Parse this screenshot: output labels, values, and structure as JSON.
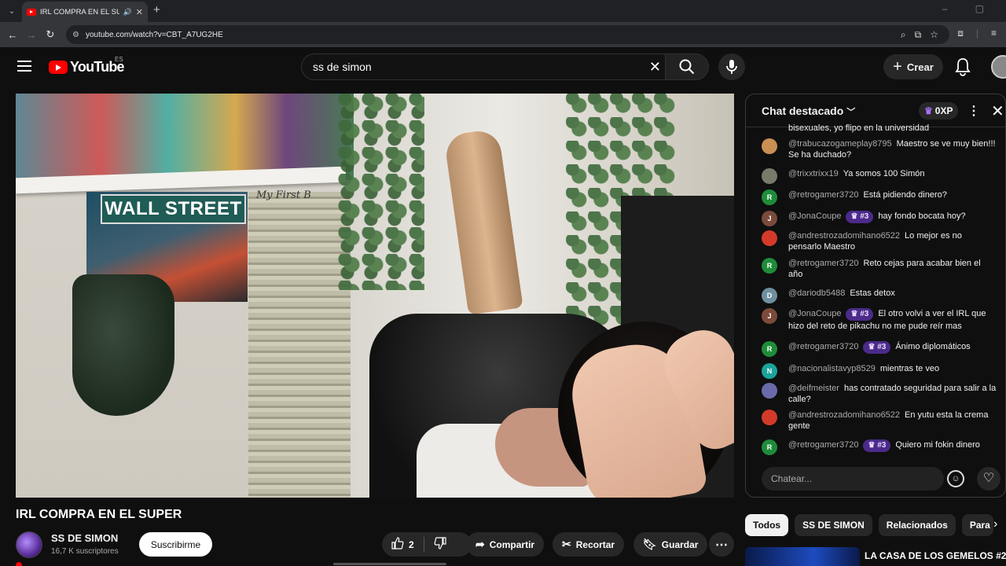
{
  "browser": {
    "tab_title": "IRL COMPRA EN EL SUPER",
    "url": "youtube.com/watch?v=CBT_A7UG2HE"
  },
  "youtube": {
    "logo_text": "YouTube",
    "country_code": "ES",
    "search_value": "ss de simon",
    "create_label": "Crear"
  },
  "video": {
    "poster_text": "WALL STREET",
    "poster_subtext": "My First B"
  },
  "chat": {
    "title": "Chat destacado",
    "xp_label": "0XP",
    "input_placeholder": "Chatear...",
    "messages": [
      {
        "user": "",
        "text": "bisexuales, yo flipo en la universidad",
        "initial": "",
        "color": "#0f0f0f"
      },
      {
        "user": "@trabucazogameplay8795",
        "text": "Maestro se ve muy bien!!! Se ha duchado?",
        "initial": "",
        "color": "#c98f54"
      },
      {
        "user": "@trixxtrixx19",
        "text": "Ya somos 100 Simón",
        "initial": "",
        "color": "#7a7a6a"
      },
      {
        "user": "@retrogamer3720",
        "text": "Está pidiendo dinero?",
        "initial": "R",
        "color": "#1f8c3a"
      },
      {
        "user": "@JonaCoupe",
        "badge": "#3",
        "text": "hay fondo bocata hoy?",
        "initial": "J",
        "color": "#7b4a3a"
      },
      {
        "user": "@andrestrozadomihano6522",
        "text": "Lo mejor es no pensarlo Maestro",
        "initial": "",
        "color": "#d43a2a"
      },
      {
        "user": "@retrogamer3720",
        "text": "Reto cejas para acabar bien el año",
        "initial": "R",
        "color": "#1f8c3a"
      },
      {
        "user": "@dariodb5488",
        "text": "Estas detox",
        "initial": "D",
        "color": "#6f8fa0"
      },
      {
        "user": "@JonaCoupe",
        "badge": "#3",
        "text": "El otro volvi a ver el IRL que hizo del reto de pikachu no me pude reír mas",
        "initial": "J",
        "color": "#7b4a3a"
      },
      {
        "user": "@retrogamer3720",
        "badge": "#3",
        "text": "Ánimo diplomáticos",
        "initial": "R",
        "color": "#1f8c3a"
      },
      {
        "user": "@nacionalistavyp8529",
        "text": "mientras te veo",
        "initial": "N",
        "color": "#1aa39a"
      },
      {
        "user": "@deifmeister",
        "text": "has contratado seguridad para salir a la calle?",
        "initial": "",
        "color": "#6a6aaa"
      },
      {
        "user": "@andrestrozadomihano6522",
        "text": "En yutu esta la crema gente",
        "initial": "",
        "color": "#d43a2a"
      },
      {
        "user": "@retrogamer3720",
        "badge": "#3",
        "text": "Quiero mi fokin dinero",
        "initial": "R",
        "color": "#1f8c3a"
      }
    ]
  },
  "below": {
    "video_title": "IRL COMPRA EN EL SUPER",
    "channel_name": "SS DE SIMON",
    "subscribers": "16,7 K suscriptores",
    "subscribe_label": "Suscribirme",
    "like_count": "2",
    "share_label": "Compartir",
    "clip_label": "Recortar",
    "save_label": "Guardar"
  },
  "chips": [
    "Todos",
    "SS DE SIMON",
    "Relacionados",
    "Para"
  ],
  "recommended": {
    "title": "LA CASA DE LOS GEMELOS #2 |"
  },
  "colors": {
    "background": "#0f0f0f",
    "youtube_red": "#ff0000",
    "member_badge": "#4b2a8a"
  }
}
